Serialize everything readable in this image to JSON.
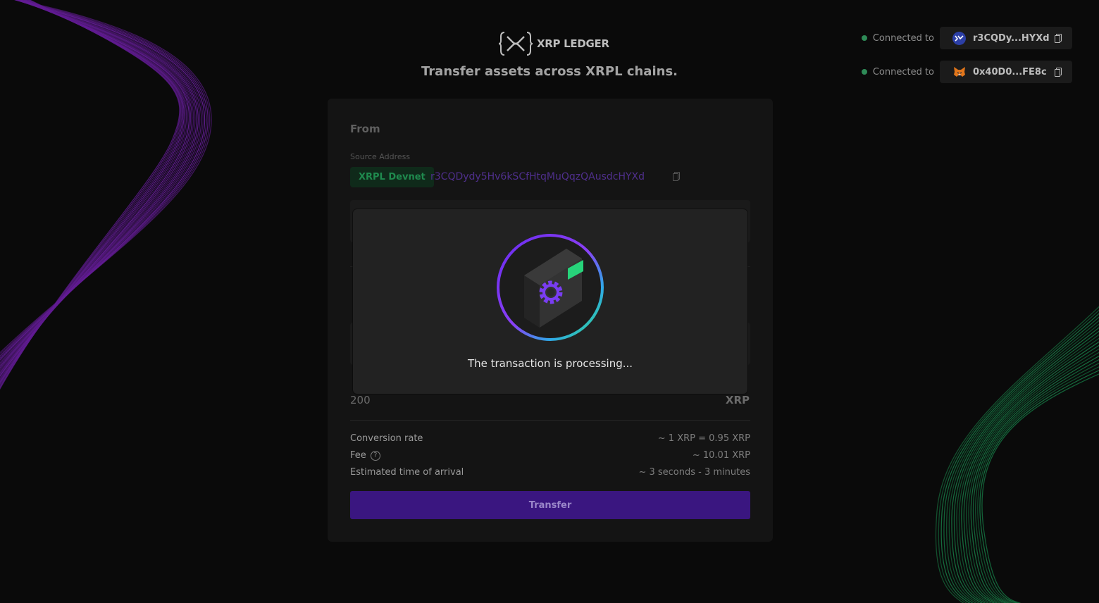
{
  "header": {
    "logo_text": "XRP LEDGER",
    "tagline": "Transfer assets across XRPL chains."
  },
  "connections": [
    {
      "label": "Connected to",
      "address": "r3CQDy...HYXd",
      "wallet": "xumm-icon"
    },
    {
      "label": "Connected to",
      "address": "0x40D0...FE8c",
      "wallet": "metamask-icon"
    }
  ],
  "form": {
    "from_title": "From",
    "source_address_label": "Source Address",
    "network_badge": "XRPL Devnet",
    "source_address": "r3CQDydy5Hv6kSCfHtqMuQqzQAusdcHYXd",
    "amount": "200",
    "amount_unit": "XRP",
    "conversion_label": "Conversion rate",
    "conversion_value": "~ 1 XRP = 0.95 XRP",
    "fee_label": "Fee",
    "fee_value": "~ 10.01 XRP",
    "eta_label": "Estimated time of arrival",
    "eta_value": "~ 3 seconds - 3 minutes",
    "transfer_button": "Transfer"
  },
  "modal": {
    "message": "The transaction is processing..."
  },
  "colors": {
    "accent_purple": "#3a1680",
    "connected_green": "#2e8b57",
    "badge_green": "#1f8a4e"
  }
}
